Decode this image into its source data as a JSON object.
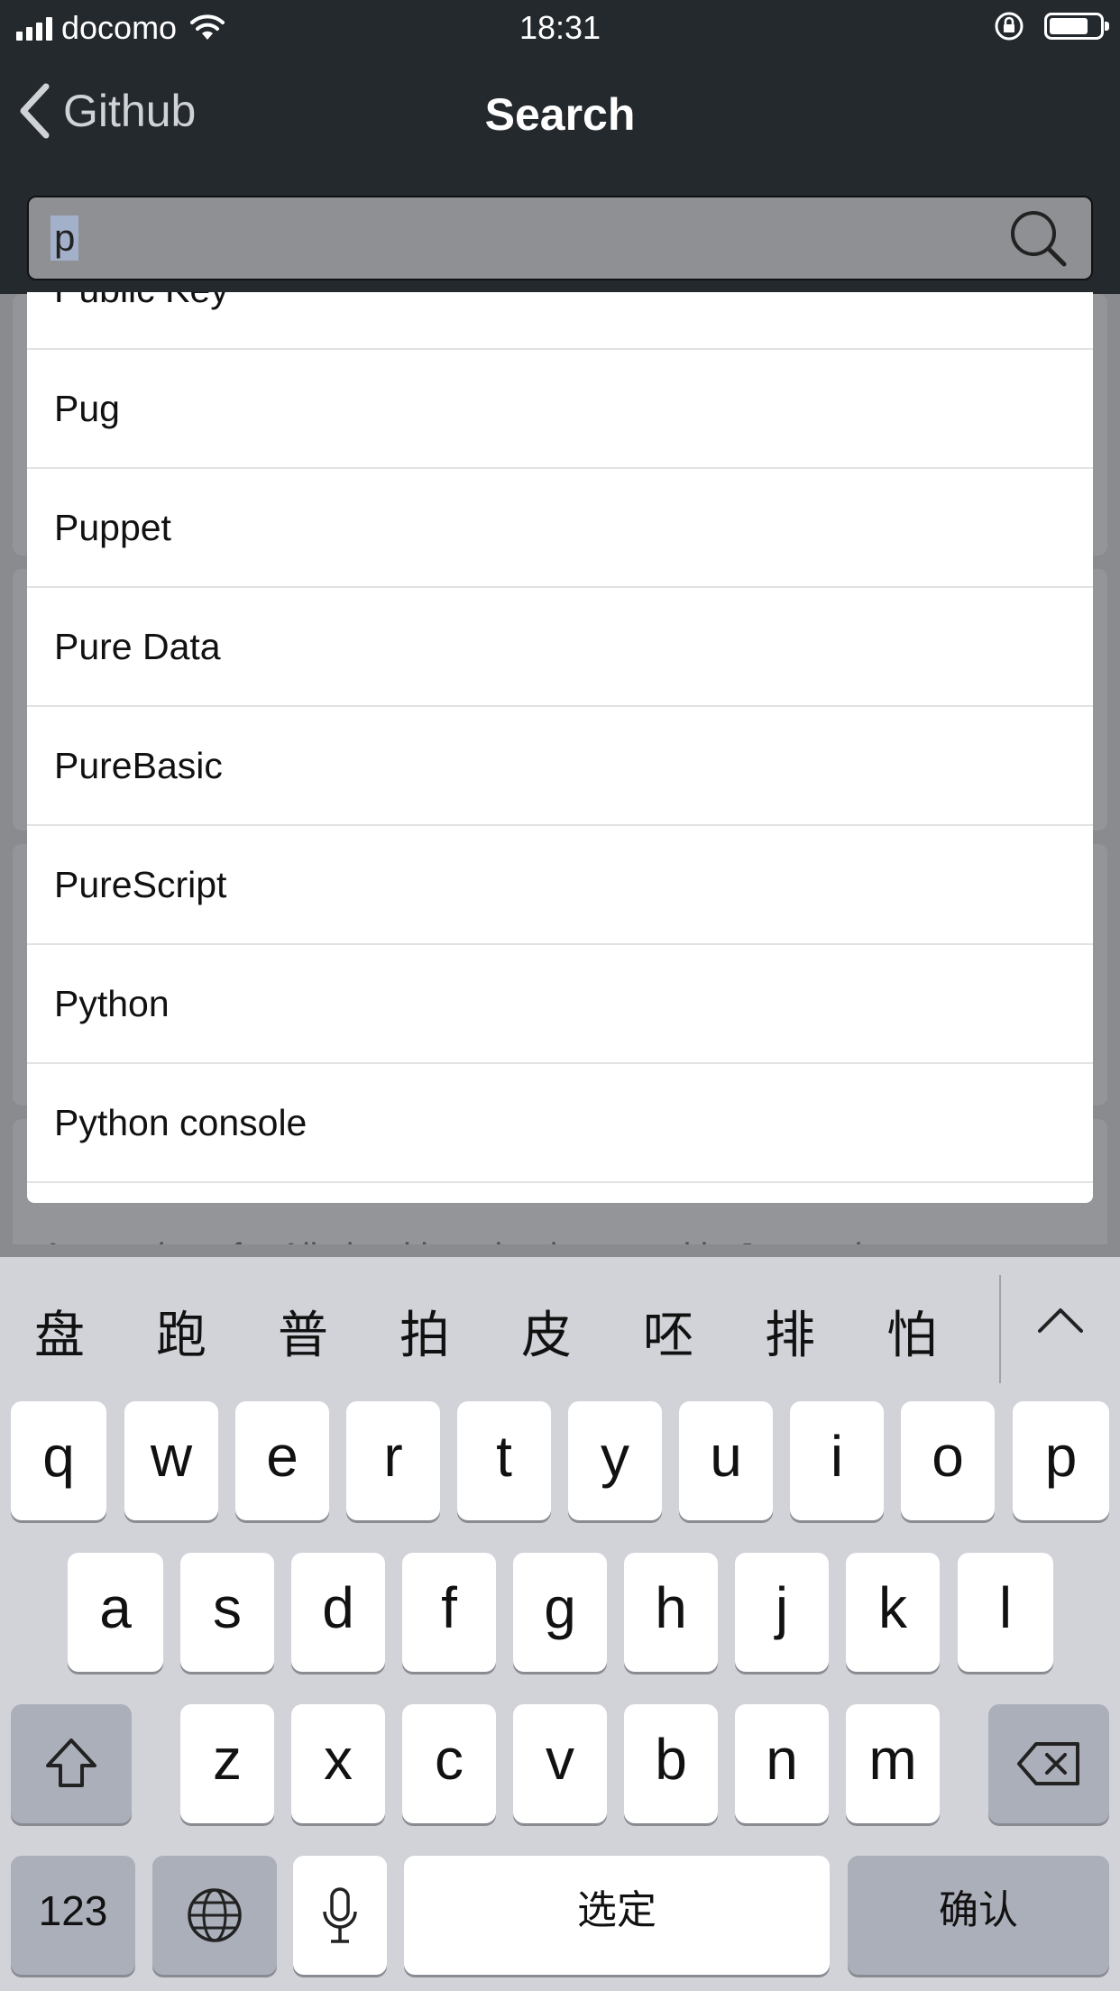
{
  "status_bar": {
    "carrier": "docomo",
    "time": "18:31"
  },
  "nav": {
    "back_label": "Github",
    "title": "Search"
  },
  "search": {
    "value": "p"
  },
  "dropdown": {
    "partial_top_item": "Public Key",
    "items": [
      "Pug",
      "Puppet",
      "Pure Data",
      "PureBasic",
      "PureScript",
      "Python",
      "Python console"
    ]
  },
  "background": {
    "partial_text": "A repository for All algorithms implemented in Javascript"
  },
  "keyboard": {
    "candidates": [
      "盘",
      "跑",
      "普",
      "拍",
      "皮",
      "呸",
      "排",
      "怕"
    ],
    "row1": [
      "q",
      "w",
      "e",
      "r",
      "t",
      "y",
      "u",
      "i",
      "o",
      "p"
    ],
    "row2": [
      "a",
      "s",
      "d",
      "f",
      "g",
      "h",
      "j",
      "k",
      "l"
    ],
    "row3": [
      "z",
      "x",
      "c",
      "v",
      "b",
      "n",
      "m"
    ],
    "numbers_label": "123",
    "space_label": "选定",
    "return_label": "确认"
  },
  "icons": {
    "search": "search-icon",
    "back": "chevron-left-icon",
    "globe": "globe-icon",
    "mic": "microphone-icon",
    "shift": "shift-icon",
    "delete": "delete-icon",
    "collapse": "chevron-up-icon"
  }
}
